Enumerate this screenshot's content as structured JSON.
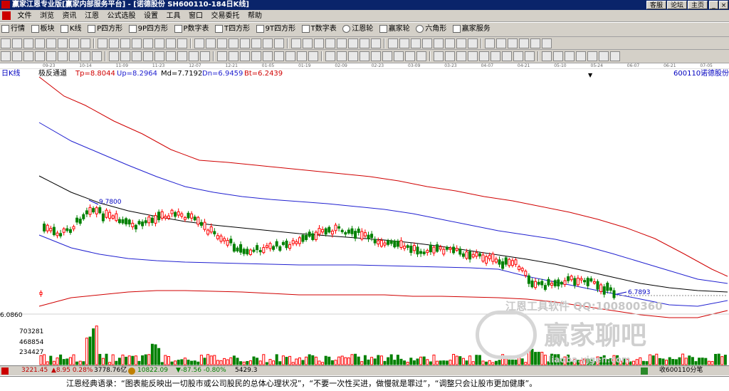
{
  "titlebar": {
    "text": "赢家江恩专业版[赢家内部服务平台] - [诺德股份  SH600110-184日K线]",
    "buttons": [
      "客服",
      "论坛",
      "主页"
    ]
  },
  "menu": [
    "文件",
    "浏览",
    "资讯",
    "江恩",
    "公式选股",
    "设置",
    "工具",
    "窗口",
    "交易委托",
    "帮助"
  ],
  "toolbar1": [
    "行情",
    "板块",
    "K线",
    "P四方形",
    "9P四方形",
    "P数字表",
    "T四方形",
    "9T四方形",
    "T数字表",
    "江恩轮",
    "赢家轮",
    "六角形",
    "赢家服务"
  ],
  "dates": [
    "09-23",
    "10-14",
    "11-09",
    "11-23",
    "12-07",
    "12-21",
    "01-05",
    "01-19",
    "02-09",
    "02-23",
    "03-09",
    "03-23",
    "04-07",
    "04-21",
    "05-10",
    "05-24",
    "06-07",
    "06-21",
    "07-05"
  ],
  "chart_header": {
    "period": "日K线",
    "indicator": "极反通道",
    "tp": "Tp=8.8044",
    "up": "Up=8.2964",
    "md": "Md=7.7192",
    "dn": "Dn=6.9459",
    "bt": "Bt=6.2439",
    "code": "600110",
    "name": "诺德股份"
  },
  "vol_axis": [
    "6.0860",
    "703281",
    "468854",
    "234427"
  ],
  "annotations": {
    "high": "9.7800",
    "low": "6.7893"
  },
  "watermark": {
    "line1": "江恩工具软件  QQ:100800360",
    "line2": "赢家聊吧",
    "line3": "liaoba.yjgen.com"
  },
  "status": {
    "sh_index": "3221.45",
    "sh_change": "▲8.95 0.28%",
    "sh_amount": "3778.76亿",
    "sz_index": "10822.09",
    "sz_change": "▼-87.56 -0.80%",
    "sz_amount": "5429.3",
    "right": "收600110分笔"
  },
  "quote": "江恩经典语录：“图表能反映出一切股市或公司股民的总体心理状况”，“不要一次性买进，做慢就是罪过”，“调整只会让股市更加健康”。",
  "colors": {
    "up": "#ff0000",
    "down": "#008000",
    "tp_line": "#d00000",
    "up_line": "#2020d0",
    "md_line": "#000000",
    "titlebar": "#0a246a",
    "chrome": "#d4d0c8"
  }
}
